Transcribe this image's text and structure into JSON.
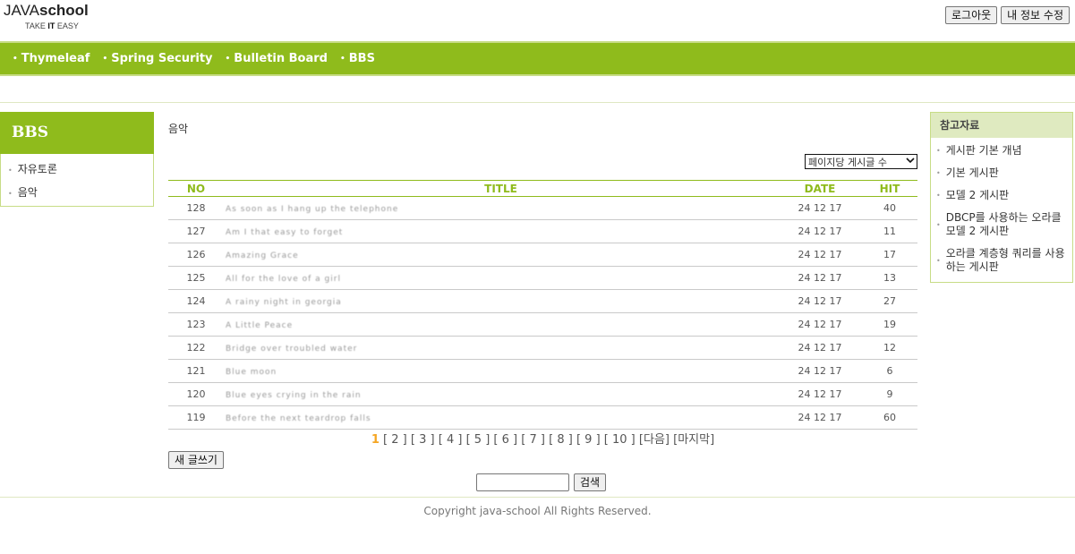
{
  "header": {
    "brand_prefix": "JAVA",
    "brand_suffix": "school",
    "tagline_pre": "TAKE ",
    "tagline_it": "IT",
    "tagline_post": " EASY",
    "logout_label": "로그아웃",
    "edit_profile_label": "내 정보 수정"
  },
  "nav": {
    "items": [
      {
        "label": "Thymeleaf"
      },
      {
        "label": "Spring Security"
      },
      {
        "label": "Bulletin Board"
      },
      {
        "label": "BBS"
      }
    ],
    "bullet": "•"
  },
  "left_sidebar": {
    "title": "BBS",
    "bullet": "•",
    "items": [
      {
        "label": "자유토론"
      },
      {
        "label": "음악"
      }
    ]
  },
  "board": {
    "name": "음악",
    "per_page_label": "페이지당 게시글 수",
    "columns": {
      "no": "NO",
      "title": "TITLE",
      "date": "DATE",
      "hit": "HIT"
    },
    "rows": [
      {
        "no": "128",
        "title": "As soon as I hang up the telephone",
        "date": "24 12 17",
        "hit": "40"
      },
      {
        "no": "127",
        "title": "Am I that easy to forget",
        "date": "24 12 17",
        "hit": "11"
      },
      {
        "no": "126",
        "title": "Amazing Grace",
        "date": "24 12 17",
        "hit": "17"
      },
      {
        "no": "125",
        "title": "All for the love of a girl",
        "date": "24 12 17",
        "hit": "13"
      },
      {
        "no": "124",
        "title": "A rainy night in georgia",
        "date": "24 12 17",
        "hit": "27"
      },
      {
        "no": "123",
        "title": "A Little Peace",
        "date": "24 12 17",
        "hit": "19"
      },
      {
        "no": "122",
        "title": "Bridge over troubled water",
        "date": "24 12 17",
        "hit": "12"
      },
      {
        "no": "121",
        "title": "Blue moon",
        "date": "24 12 17",
        "hit": "6"
      },
      {
        "no": "120",
        "title": "Blue eyes crying in the rain",
        "date": "24 12 17",
        "hit": "9"
      },
      {
        "no": "119",
        "title": "Before the next teardrop falls",
        "date": "24 12 17",
        "hit": "60"
      }
    ],
    "paging": {
      "current": "1",
      "pages": [
        "2",
        "3",
        "4",
        "5",
        "6",
        "7",
        "8",
        "9",
        "10"
      ],
      "next_label": "[다음]",
      "last_label": "[마지막]"
    },
    "write_label": "새 글쓰기",
    "search_button_label": "검색"
  },
  "right_sidebar": {
    "title": "참고자료",
    "bullet": "•",
    "items": [
      {
        "label": "게시판 기본 개념"
      },
      {
        "label": "기본 게시판"
      },
      {
        "label": "모델 2 게시판"
      },
      {
        "label": "DBCP를 사용하는 오라클 모델 2 게시판"
      },
      {
        "label": "오라클 계층형 쿼리를 사용하는 게시판"
      }
    ]
  },
  "footer": {
    "copyright": "Copyright java-school All Rights Reserved."
  },
  "colors": {
    "accent": "#8fbb1c",
    "current_page": "#f5a623"
  }
}
